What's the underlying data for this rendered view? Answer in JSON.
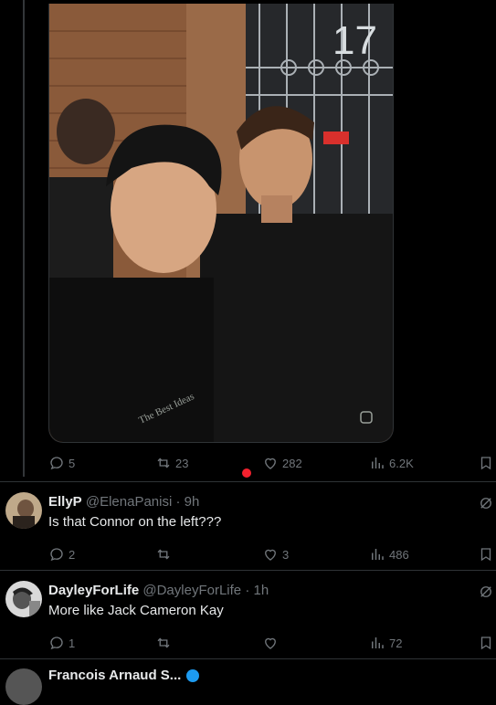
{
  "main_post": {
    "stats": {
      "replies": "5",
      "reposts": "23",
      "likes": "282",
      "views": "6.2K"
    }
  },
  "replies": [
    {
      "name": "EllyP",
      "handle": "@ElenaPanisi",
      "time": "· 9h",
      "text": "Is that Connor on the left???",
      "stats": {
        "replies": "2",
        "reposts": "",
        "likes": "3",
        "views": "486"
      }
    },
    {
      "name": "DayleyForLife",
      "handle": "@DayleyForLife",
      "time": "· 1h",
      "text": "More like Jack Cameron Kay",
      "stats": {
        "replies": "1",
        "reposts": "",
        "likes": "",
        "views": "72"
      }
    }
  ],
  "next_reply_partial": {
    "name": "Francois Arnaud S..."
  },
  "colors": {
    "background": "#000000",
    "text": "#e7e9ea",
    "muted": "#71767b",
    "divider": "#2f3336",
    "accent": "#1d9bf0",
    "live": "#f4212e"
  },
  "icons": {
    "reply": "reply-icon",
    "repost": "repost-icon",
    "like": "heart-icon",
    "views": "views-icon",
    "bookmark": "bookmark-icon",
    "grok": "grok-icon"
  }
}
